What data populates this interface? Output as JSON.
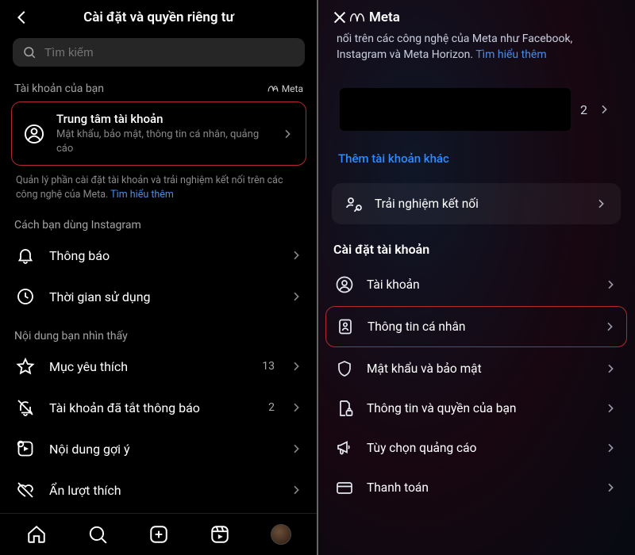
{
  "left": {
    "header_title": "Cài đặt và quyền riêng tư",
    "search_placeholder": "Tìm kiếm",
    "meta_brand": "Meta",
    "section_account": "Tài khoản của bạn",
    "card": {
      "title": "Trung tâm tài khoản",
      "sub": "Mật khẩu, bảo mật, thông tin cá nhân, quảng cáo"
    },
    "desc_prefix": "Quản lý phần cài đặt tài khoản và trải nghiệm kết nối trên các công nghệ của Meta. ",
    "desc_link": "Tìm hiểu thêm",
    "section_usage": "Cách bạn dùng Instagram",
    "rows_usage": [
      {
        "label": "Thông báo"
      },
      {
        "label": "Thời gian sử dụng"
      }
    ],
    "section_content": "Nội dung bạn nhìn thấy",
    "rows_content": [
      {
        "label": "Mục yêu thích",
        "trail": "13"
      },
      {
        "label": "Tài khoản đã tắt thông báo",
        "trail": "2"
      },
      {
        "label": "Nội dung gợi ý"
      },
      {
        "label": "Ẩn lượt thích"
      }
    ]
  },
  "right": {
    "desc_prefix": "nối trên các công nghệ của Meta như Facebook, Instagram và Meta Horizon. ",
    "desc_link": "Tìm hiểu thêm",
    "meta_brand": "Meta",
    "account_count": "2",
    "add_account": "Thêm tài khoản khác",
    "connected_exp": "Trải nghiệm kết nối",
    "section_settings": "Cài đặt tài khoản",
    "rows": [
      {
        "label": "Tài khoản"
      },
      {
        "label": "Thông tin cá nhân"
      },
      {
        "label": "Mật khẩu và bảo mật"
      },
      {
        "label": "Thông tin và quyền của bạn"
      },
      {
        "label": "Tùy chọn quảng cáo"
      },
      {
        "label": "Thanh toán"
      }
    ]
  }
}
